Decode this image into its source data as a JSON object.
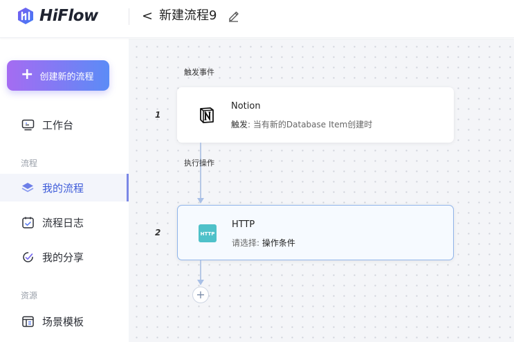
{
  "header": {
    "logo_text": "HiFlow",
    "back_glyph": "<",
    "flow_title": "新建流程9"
  },
  "sidebar": {
    "create_button": {
      "plus": "+",
      "label": "创建新的流程"
    },
    "workbench": {
      "label": "工作台",
      "icon": "monitor-icon"
    },
    "section_flow": "流程",
    "my_flows": {
      "label": "我的流程",
      "icon": "layers-icon",
      "active": true
    },
    "flow_logs": {
      "label": "流程日志",
      "icon": "calendar-check-icon"
    },
    "my_shares": {
      "label": "我的分享",
      "icon": "share-icon"
    },
    "section_resources": "资源",
    "templates": {
      "label": "场景模板",
      "icon": "template-icon"
    }
  },
  "canvas": {
    "trigger_caption": "触发事件",
    "action_caption": "执行操作",
    "steps": [
      {
        "num": "1",
        "app": "Notion",
        "key": "触发",
        "sep": ":",
        "value": "当有新的Database Item创建时",
        "icon": "notion-icon"
      },
      {
        "num": "2",
        "app": "HTTP",
        "key": "请选择",
        "sep": ":",
        "value": "操作条件",
        "icon": "http-icon",
        "icon_text": "HTTP"
      }
    ],
    "add_button": "+"
  },
  "colors": {
    "accent": "#3d5bd9",
    "create_gradient_start": "#a56cf2",
    "create_gradient_end": "#5b8cf6",
    "http_icon_bg": "#4fc1c9",
    "connector": "#b6c8e6"
  }
}
